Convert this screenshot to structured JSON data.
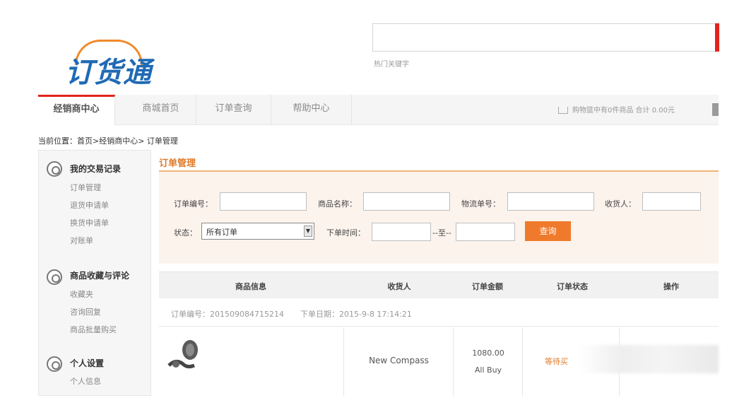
{
  "header": {
    "logo_text": "订货通",
    "search_placeholder": "",
    "hot_keywords_label": "热门关键字"
  },
  "nav": {
    "tabs": [
      {
        "label": "经销商中心",
        "active": true
      },
      {
        "label": "商城首页",
        "active": false
      },
      {
        "label": "订单查询",
        "active": false
      },
      {
        "label": "帮助中心",
        "active": false
      }
    ],
    "cart_text": "购物篮中有0件商品 合计 0.00元"
  },
  "breadcrumb": "当前位置：首页>经销商中心> 订单管理",
  "sidebar": {
    "groups": [
      {
        "title": "我的交易记录",
        "icon": "edit-icon",
        "items": [
          "订单管理",
          "退货申请单",
          "换货申请单",
          "对账单"
        ]
      },
      {
        "title": "商品收藏与评论",
        "icon": "comment-icon",
        "items": [
          "收藏夹",
          "咨询回复",
          "商品批量购买"
        ]
      },
      {
        "title": "个人设置",
        "icon": "settings-icon",
        "items": [
          "个人信息"
        ]
      }
    ]
  },
  "main": {
    "title": "订单管理",
    "filters": {
      "order_no_label": "订单编号：",
      "product_name_label": "商品名称：",
      "logistics_no_label": "物流单号：",
      "receiver_label": "收货人：",
      "status_label": "状态：",
      "status_value": "所有订单",
      "order_time_label": "下单时间：",
      "range_sep": "--至--",
      "query_button": "查询"
    },
    "table": {
      "headers": [
        "商品信息",
        "收货人",
        "订单金额",
        "订单状态",
        "操作"
      ],
      "orders": [
        {
          "order_no_text": "订单编号：201509084715214",
          "order_date_text": "下单日期：2015-9-8 17:14:21",
          "receiver": "New Compass",
          "amount": "1080.00",
          "payment": "All Buy",
          "status": "等待买"
        }
      ]
    }
  },
  "colors": {
    "brand_orange": "#f07a2c",
    "brand_blue": "#1f6ab5",
    "nav_active_accent": "#e2231a"
  }
}
